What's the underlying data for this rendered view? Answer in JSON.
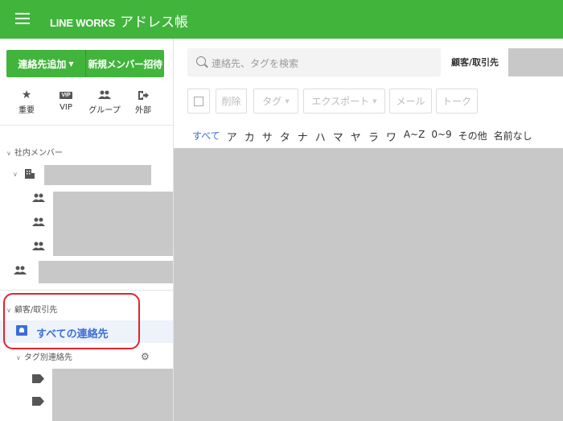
{
  "header": {
    "brand": "LINE WORKS",
    "app_name": "アドレス帳",
    "color": "#41b43c"
  },
  "sidebar": {
    "add_contact_label": "連絡先追加",
    "invite_member_label": "新規メンバー招待",
    "quick_links": [
      {
        "label": "重要",
        "icon": "star-icon"
      },
      {
        "label": "VIP",
        "icon": "vip-icon",
        "badge": "VIP"
      },
      {
        "label": "グループ",
        "icon": "group-icon"
      },
      {
        "label": "外部",
        "icon": "external-icon"
      }
    ],
    "internal_section": "社内メンバー",
    "customer_section": "顧客/取引先",
    "all_contacts_label": "すべての連絡先",
    "tag_section": "タグ別連絡先"
  },
  "main": {
    "search_placeholder": "連絡先、タグを検索",
    "customer_label": "顧客/取引先",
    "toolbar": {
      "delete": "削除",
      "tag": "タグ",
      "export": "エクスポート",
      "mail": "メール",
      "talk": "トーク"
    },
    "index": [
      "すべて",
      "ア",
      "カ",
      "サ",
      "タ",
      "ナ",
      "ハ",
      "マ",
      "ヤ",
      "ラ",
      "ワ",
      "A~Z",
      "0~9",
      "その他",
      "名前なし"
    ]
  },
  "colors": {
    "accent_blue": "#3b6fd6",
    "highlight_red": "#e0232d"
  }
}
